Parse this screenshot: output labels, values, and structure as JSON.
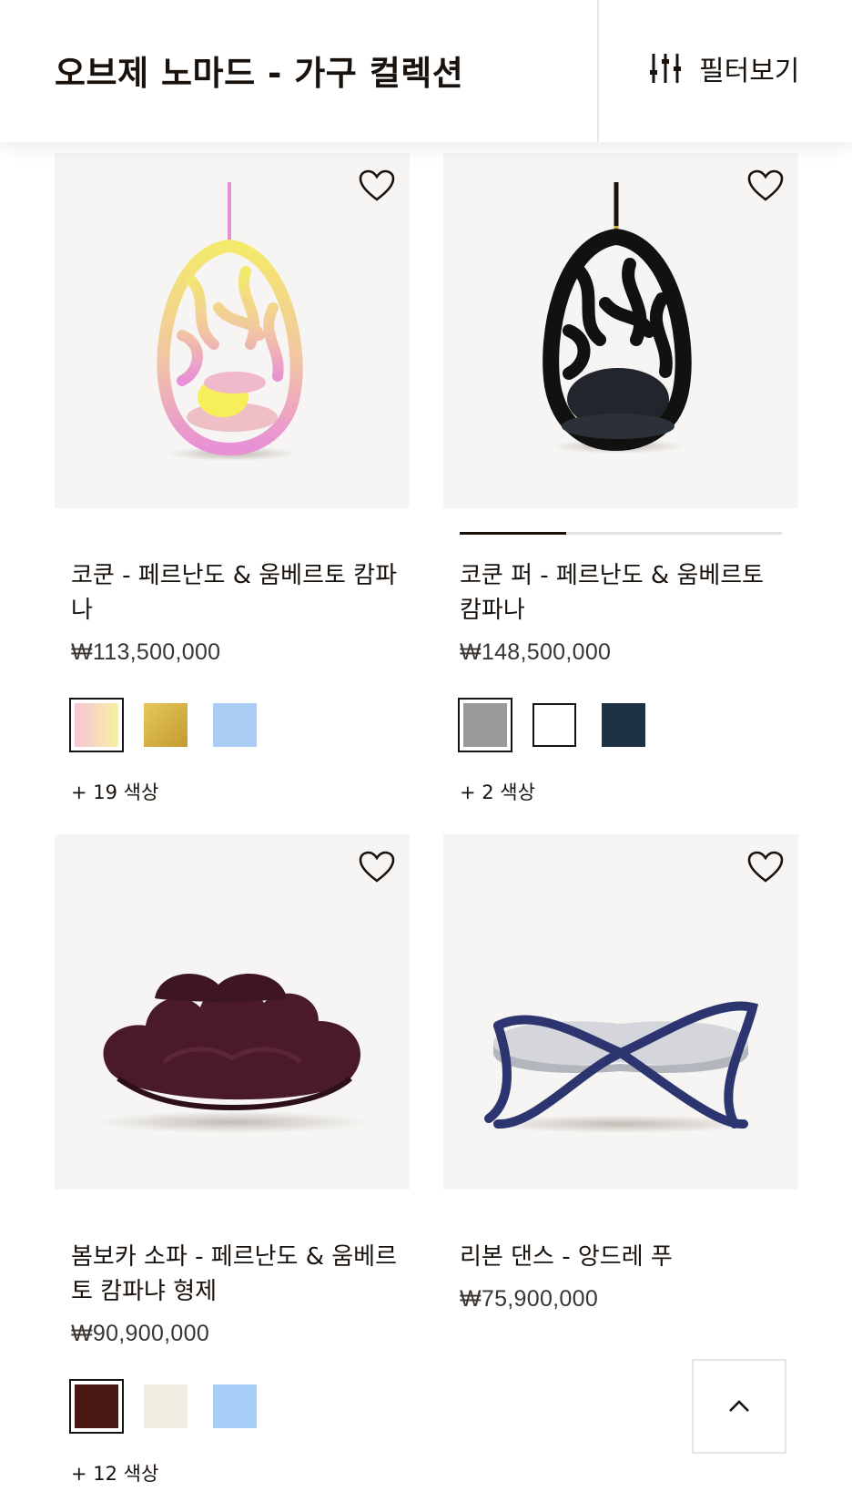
{
  "header": {
    "title": "오브제 노마드 - 가구 컬렉션",
    "filter_label": "필터보기",
    "filter_icon": "sliders-icon"
  },
  "products": [
    {
      "name": "코쿤 - 페르난도 & 움베르토 캄파나",
      "price": "₩113,500,000",
      "swatches": [
        "#f7c8d6",
        "#d4b04a",
        "#a9cdf5"
      ],
      "more_colors": "+ 19 색상"
    },
    {
      "name": "코쿤 퍼 - 페르난도 & 움베르토 캄파나",
      "price": "₩148,500,000",
      "swatches": [
        "#9a9a9d",
        "#ffffff",
        "#1e3246"
      ],
      "more_colors": "+ 2 색상",
      "image_progress": 0.33
    },
    {
      "name": "봄보카 소파 - 페르난도 & 움베르토 캄파냐 형제",
      "price": "₩90,900,000",
      "swatches": [
        "#4a1915",
        "#f1ece0",
        "#a6cdf6"
      ],
      "more_colors": "+ 12 색상"
    },
    {
      "name": "리본 댄스 - 앙드레 푸",
      "price": "₩75,900,000"
    }
  ],
  "icons": {
    "wishlist": "heart-icon",
    "back_to_top": "chevron-up-icon"
  }
}
